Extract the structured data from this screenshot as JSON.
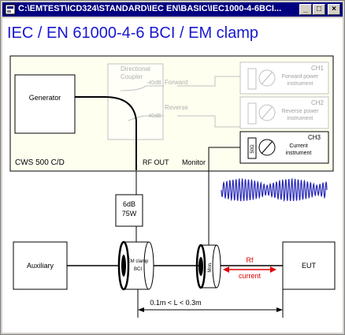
{
  "window": {
    "title": "C:\\EMTEST\\ICD324\\STANDARD\\IEC EN\\BASIC\\IEC1000-4-6BCI...",
    "minimize_glyph": "_",
    "maximize_glyph": "□",
    "close_glyph": "×"
  },
  "page": {
    "heading": "IEC / EN 61000-4-6  BCI / EM clamp"
  },
  "diagram": {
    "generator": "Generator",
    "coupler_line1": "Directional",
    "coupler_line2": "Coupler",
    "forward_db": "-40dB",
    "forward": "Forward",
    "reverse_db": "-40dB",
    "reverse": "Reverse",
    "ch1": "CH1",
    "ch1_line1": "Forward power",
    "ch1_line2": "instrument",
    "ch2": "CH2",
    "ch2_line1": "Reverse power",
    "ch2_line2": "instrument",
    "ch3": "CH3",
    "ch3_line1": "Current",
    "ch3_line2": "instrument",
    "probe_label": "50Ω",
    "cws": "CWS 500 C/D",
    "rf_out": "RF OUT",
    "monitor": "Monitor",
    "attenuator_line1": "6dB",
    "attenuator_line2": "75W",
    "auxiliary": "Auxiliary",
    "clamp_label1": "EM clamp",
    "clamp_label2": "BCI",
    "monitor_probe": "Mon.",
    "rf_current_line1": "Rf",
    "rf_current_line2": "current",
    "eut": "EUT",
    "distance": "0.1m < L < 0.3m"
  },
  "colors": {
    "title_bar": "#000080",
    "heading": "#1818d0",
    "cws_box": "#fffff0",
    "waveform": "#2828b8",
    "rf_current": "#e00000",
    "faded": "#b8b8b8"
  }
}
